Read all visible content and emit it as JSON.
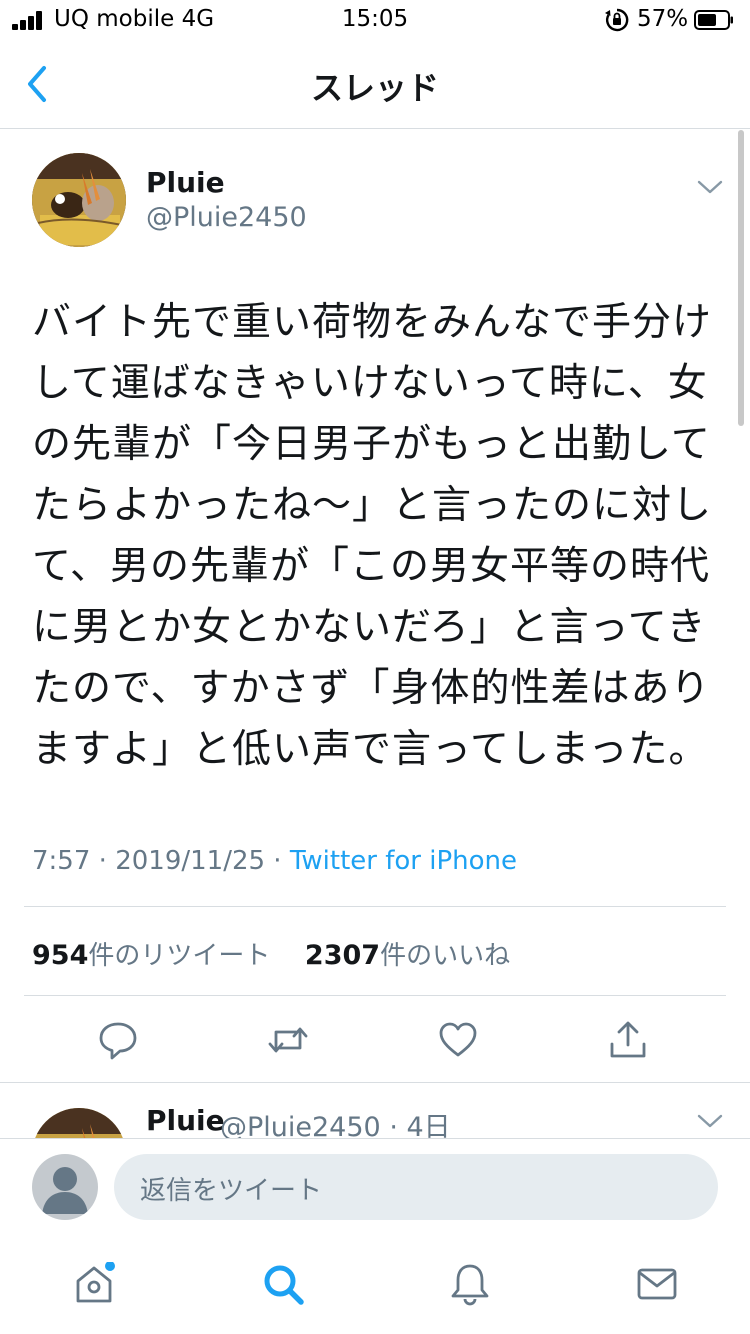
{
  "status": {
    "carrier": "UQ mobile 4G",
    "time": "15:05",
    "battery": "57%"
  },
  "nav": {
    "title": "スレッド"
  },
  "tweet": {
    "name": "Pluie",
    "handle": "@Pluie2450",
    "text": "バイト先で重い荷物をみんなで手分けして運ばなきゃいけないって時に、女の先輩が「今日男子がもっと出勤してたらよかったね〜」と言ったのに対して、男の先輩が「この男女平等の時代に男とか女とかないだろ」と言ってきたので、すかさず「身体的性差はありますよ」と低い声で言ってしまった。",
    "time": "7:57",
    "date": "2019/11/25",
    "source": "Twitter for iPhone",
    "retweet_count": "954",
    "retweet_label": "件のリツイート",
    "like_count": "2307",
    "like_label": "件のいいね"
  },
  "reply": {
    "name": "Pluie",
    "handle": "@Pluie2450",
    "age": "4日"
  },
  "compose": {
    "placeholder": "返信をツイート"
  },
  "colors": {
    "accent": "#1da1f2",
    "secondary_text": "#657786",
    "divider": "#d8dde1"
  }
}
